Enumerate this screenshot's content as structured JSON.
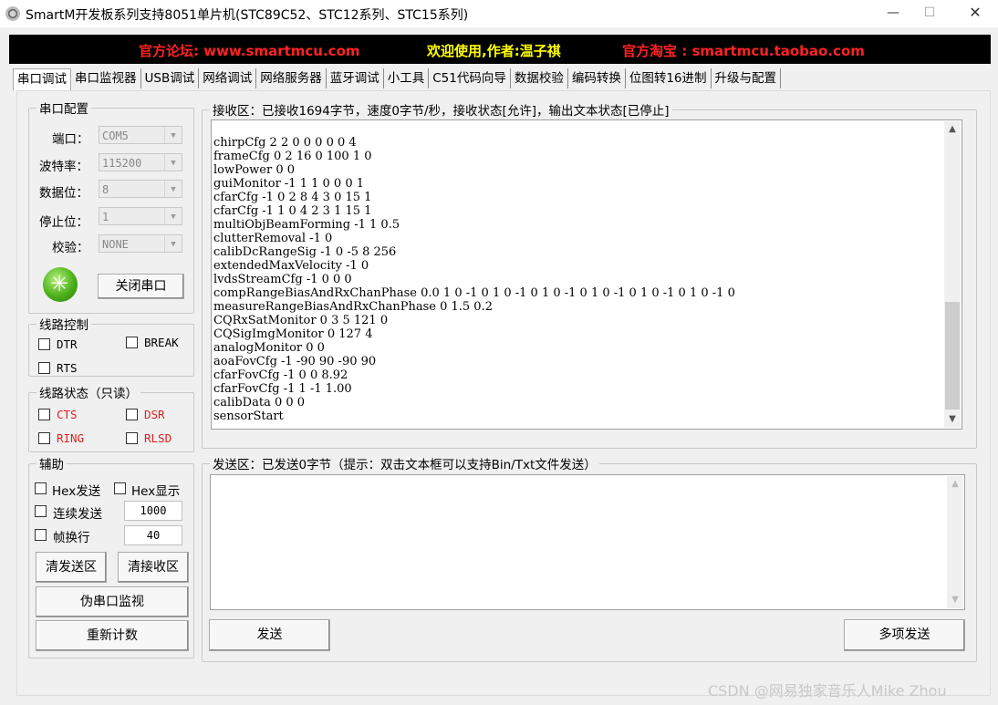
{
  "window": {
    "title": "SmartM开发板系列支持8051单片机(STC89C52、STC12系列、STC15系列)",
    "minimize": "—",
    "maximize": "☐",
    "close": "✕"
  },
  "banner": {
    "forum": "官方论坛: www.smartmcu.com",
    "welcome": "欢迎使用,作者:温子祺",
    "shop": "官方淘宝 : smartmcu.taobao.com"
  },
  "tabs": [
    "串口调试",
    "串口监视器",
    "USB调试",
    "网络调试",
    "网络服务器",
    "蓝牙调试",
    "小工具",
    "C51代码向导",
    "数据校验",
    "编码转换",
    "位图转16进制",
    "升级与配置"
  ],
  "serial_config": {
    "legend": "串口配置",
    "port_label": "端口：",
    "port_value": "COM5",
    "baud_label": "波特率：",
    "baud_value": "115200",
    "databits_label": "数据位：",
    "databits_value": "8",
    "stopbits_label": "停止位：",
    "stopbits_value": "1",
    "parity_label": "校验：",
    "parity_value": "NONE",
    "close_port_button": "关闭串口"
  },
  "line_control": {
    "legend": "线路控制",
    "dtr": "DTR",
    "break": "BREAK",
    "rts": "RTS"
  },
  "line_status": {
    "legend": "线路状态（只读）",
    "cts": "CTS",
    "dsr": "DSR",
    "ring": "RING",
    "rlsd": "RLSD"
  },
  "aux": {
    "legend": "辅助",
    "hex_send": "Hex发送",
    "hex_display": "Hex显示",
    "continuous_send": "连续发送",
    "continuous_interval": "1000",
    "frame_newline": "帧换行",
    "frame_value": "40",
    "clear_send_button": "清发送区",
    "clear_recv_button": "清接收区",
    "pseudo_monitor_button": "伪串口监视",
    "recount_button": "重新计数"
  },
  "receive": {
    "legend": "接收区：已接收1694字节，速度0字节/秒，接收状态[允许]，输出文本状态[已停止]",
    "lines": [
      "chirpCfg 2 2 0 0 0 0 0 4",
      "frameCfg 0 2 16 0 100 1 0",
      "lowPower 0 0",
      "guiMonitor -1 1 1 0 0 0 1",
      "cfarCfg -1 0 2 8 4 3 0 15 1",
      "cfarCfg -1 1 0 4 2 3 1 15 1",
      "multiObjBeamForming -1 1 0.5",
      "clutterRemoval -1 0",
      "calibDcRangeSig -1 0 -5 8 256",
      "extendedMaxVelocity -1 0",
      "lvdsStreamCfg -1 0 0 0",
      "compRangeBiasAndRxChanPhase 0.0 1 0 -1 0 1 0 -1 0 1 0 -1 0 1 0 -1 0 1 0 -1 0 1 0 -1 0",
      "measureRangeBiasAndRxChanPhase 0 1.5 0.2",
      "CQRxSatMonitor 0 3 5 121 0",
      "CQSigImgMonitor 0 127 4",
      "analogMonitor 0 0",
      "aoaFovCfg -1 -90 90 -90 90",
      "cfarFovCfg -1 0 0 8.92",
      "cfarFovCfg -1 1 -1 1.00",
      "calibData 0 0 0",
      "sensorStart"
    ]
  },
  "send": {
    "legend": "发送区：已发送0字节（提示：双击文本框可以支持Bin/Txt文件发送）",
    "send_button": "发送",
    "multi_send_button": "多项发送"
  },
  "watermark": "CSDN @网易独家音乐人Mike Zhou",
  "colors": {
    "banner_bg": "#000000",
    "banner_red": "#ff2222",
    "banner_yellow": "#ffff00",
    "led_green": "#4bb11a",
    "status_red": "#e02020"
  }
}
